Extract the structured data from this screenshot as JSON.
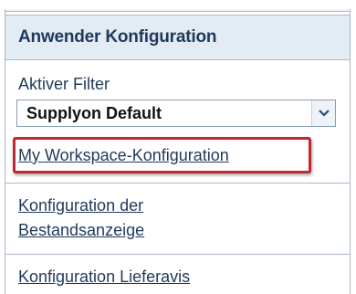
{
  "panel": {
    "title": "Anwender Konfiguration"
  },
  "filter": {
    "label": "Aktiver Filter",
    "selected": "Supplyon Default"
  },
  "links": {
    "workspace_config": "My Workspace-Konfiguration",
    "inventory_config_line1": "Konfiguration der",
    "inventory_config_line2": "Bestandsanzeige",
    "delivery_notice_config": "Konfiguration Lieferavis"
  },
  "colors": {
    "header_bg": "#e3ebf5",
    "text": "#1f3a5c",
    "highlight": "#c0282d"
  }
}
